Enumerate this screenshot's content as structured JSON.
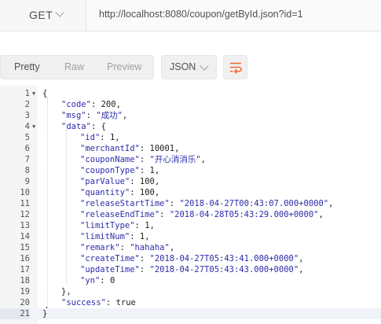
{
  "request": {
    "method": "GET",
    "url": "http://localhost:8080/coupon/getById.json?id=1"
  },
  "response": {
    "view_tabs": [
      {
        "label": "Pretty",
        "active": true
      },
      {
        "label": "Raw",
        "active": false
      },
      {
        "label": "Preview",
        "active": false
      }
    ],
    "format": "JSON",
    "wrap_icon": "wrap-lines-icon",
    "accent_color": "#f26b3a",
    "lines": [
      {
        "n": "1",
        "fold": true,
        "indent": 0,
        "parts": [
          [
            "p",
            "{"
          ]
        ]
      },
      {
        "n": "2",
        "indent": 1,
        "parts": [
          [
            "k",
            "\"code\""
          ],
          [
            "p",
            ": "
          ],
          [
            "n",
            "200"
          ],
          [
            "p",
            ","
          ]
        ]
      },
      {
        "n": "3",
        "indent": 1,
        "parts": [
          [
            "k",
            "\"msg\""
          ],
          [
            "p",
            ": "
          ],
          [
            "s",
            "\"成功\""
          ],
          [
            "p",
            ","
          ]
        ]
      },
      {
        "n": "4",
        "fold": true,
        "indent": 1,
        "parts": [
          [
            "k",
            "\"data\""
          ],
          [
            "p",
            ": {"
          ]
        ]
      },
      {
        "n": "5",
        "indent": 2,
        "parts": [
          [
            "k",
            "\"id\""
          ],
          [
            "p",
            ": "
          ],
          [
            "n",
            "1"
          ],
          [
            "p",
            ","
          ]
        ]
      },
      {
        "n": "6",
        "indent": 2,
        "parts": [
          [
            "k",
            "\"merchantId\""
          ],
          [
            "p",
            ": "
          ],
          [
            "n",
            "10001"
          ],
          [
            "p",
            ","
          ]
        ]
      },
      {
        "n": "7",
        "indent": 2,
        "parts": [
          [
            "k",
            "\"couponName\""
          ],
          [
            "p",
            ": "
          ],
          [
            "s",
            "\"开心消消乐\""
          ],
          [
            "p",
            ","
          ]
        ]
      },
      {
        "n": "8",
        "indent": 2,
        "parts": [
          [
            "k",
            "\"couponType\""
          ],
          [
            "p",
            ": "
          ],
          [
            "n",
            "1"
          ],
          [
            "p",
            ","
          ]
        ]
      },
      {
        "n": "9",
        "indent": 2,
        "parts": [
          [
            "k",
            "\"parValue\""
          ],
          [
            "p",
            ": "
          ],
          [
            "n",
            "100"
          ],
          [
            "p",
            ","
          ]
        ]
      },
      {
        "n": "10",
        "indent": 2,
        "parts": [
          [
            "k",
            "\"quantity\""
          ],
          [
            "p",
            ": "
          ],
          [
            "n",
            "100"
          ],
          [
            "p",
            ","
          ]
        ]
      },
      {
        "n": "11",
        "indent": 2,
        "parts": [
          [
            "k",
            "\"releaseStartTime\""
          ],
          [
            "p",
            ": "
          ],
          [
            "s",
            "\"2018-04-27T00:43:07.000+0000\""
          ],
          [
            "p",
            ","
          ]
        ]
      },
      {
        "n": "12",
        "indent": 2,
        "parts": [
          [
            "k",
            "\"releaseEndTime\""
          ],
          [
            "p",
            ": "
          ],
          [
            "s",
            "\"2018-04-28T05:43:29.000+0000\""
          ],
          [
            "p",
            ","
          ]
        ]
      },
      {
        "n": "13",
        "indent": 2,
        "parts": [
          [
            "k",
            "\"limitType\""
          ],
          [
            "p",
            ": "
          ],
          [
            "n",
            "1"
          ],
          [
            "p",
            ","
          ]
        ]
      },
      {
        "n": "14",
        "indent": 2,
        "parts": [
          [
            "k",
            "\"limitNum\""
          ],
          [
            "p",
            ": "
          ],
          [
            "n",
            "1"
          ],
          [
            "p",
            ","
          ]
        ]
      },
      {
        "n": "15",
        "indent": 2,
        "parts": [
          [
            "k",
            "\"remark\""
          ],
          [
            "p",
            ": "
          ],
          [
            "s",
            "\"hahaha\""
          ],
          [
            "p",
            ","
          ]
        ]
      },
      {
        "n": "16",
        "indent": 2,
        "parts": [
          [
            "k",
            "\"createTime\""
          ],
          [
            "p",
            ": "
          ],
          [
            "s",
            "\"2018-04-27T05:43:41.000+0000\""
          ],
          [
            "p",
            ","
          ]
        ]
      },
      {
        "n": "17",
        "indent": 2,
        "parts": [
          [
            "k",
            "\"updateTime\""
          ],
          [
            "p",
            ": "
          ],
          [
            "s",
            "\"2018-04-27T05:43:43.000+0000\""
          ],
          [
            "p",
            ","
          ]
        ]
      },
      {
        "n": "18",
        "indent": 2,
        "parts": [
          [
            "k",
            "\"yn\""
          ],
          [
            "p",
            ": "
          ],
          [
            "n",
            "0"
          ]
        ]
      },
      {
        "n": "19",
        "indent": 1,
        "parts": [
          [
            "p",
            "},"
          ]
        ]
      },
      {
        "n": "20",
        "indent": 1,
        "parts": [
          [
            "k",
            "\"success\""
          ],
          [
            "p",
            ": "
          ],
          [
            "n",
            "true"
          ]
        ]
      },
      {
        "n": "21",
        "indent": 0,
        "active": true,
        "parts": [
          [
            "p",
            "}"
          ]
        ]
      }
    ]
  }
}
